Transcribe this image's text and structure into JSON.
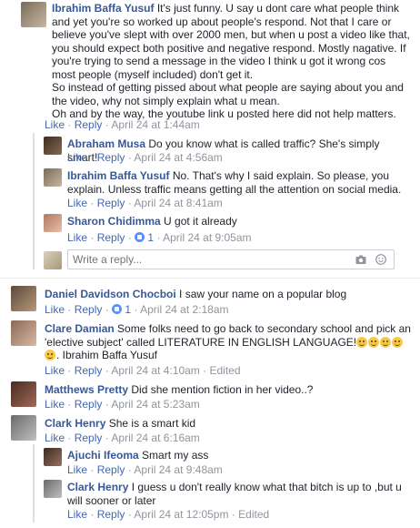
{
  "labels": {
    "like": "Like",
    "reply": "Reply",
    "dot": "·",
    "edited": "Edited"
  },
  "top_comment": {
    "author": "Ibrahim Baffa Yusuf",
    "text": "It's just funny. U say u dont care what people think and yet you're so worked up about people's respond. Not that I care or believe you've slept with over 2000 men, but when u post a video like that, you should expect both positive and negative respond. Mostly nagative. If you're trying to send a message in the video I think u got it wrong cos most people (myself included) don't get it.",
    "text2": "So instead of getting pissed about what people are saying about you and the video, why not simply explain what u mean.",
    "text3": "Oh and by the way, the youtube link u posted here did not help matters.",
    "time": "April 24 at 1:44am"
  },
  "replies": [
    {
      "author": "Abraham Musa",
      "text": "Do you know what is called traffic? She's simply smart!",
      "time": "April 24 at 4:56am"
    },
    {
      "author": "Ibrahim Baffa Yusuf",
      "text": "No. That's why I said explain. So please, you explain. Unless traffic means getting all the attention on social media.",
      "time": "April 24 at 8:41am"
    },
    {
      "author": "Sharon Chidimma",
      "text": "U got it already",
      "time": "April 24 at 9:05am",
      "likes": "1"
    }
  ],
  "reply_input": {
    "placeholder": "Write a reply..."
  },
  "comments": [
    {
      "author": "Daniel Davidson Chocboi",
      "text": "I saw your name on a popular blog",
      "time": "April 24 at 2:18am",
      "likes": "1"
    },
    {
      "author": "Clare Damian",
      "text": "Some folks need to go back to secondary school and pick an 'elective subject' called LITERATURE IN ENGLISH LANGUAGE!",
      "text_tail": ". Ibrahim Baffa Yusuf",
      "time": "April 24 at 4:10am"
    },
    {
      "author": "Matthews Pretty",
      "text": "Did she mention fiction in her video..?",
      "time": "April 24 at 5:23am"
    },
    {
      "author": "Clark Henry",
      "text": "She is a smart kid",
      "time": "April 24 at 6:16am"
    }
  ],
  "sub_replies": [
    {
      "author": "Ajuchi Ifeoma",
      "text": "Smart my ass",
      "time": "April 24 at 9:48am"
    },
    {
      "author": "Clark Henry",
      "text": "I guess u don't really know what that bitch is up to ,but u will sooner or later",
      "time": "April 24 at 12:05pm"
    }
  ],
  "colors": {
    "link": "#365899",
    "action": "#4267b2",
    "meta": "#90949c",
    "text": "#1d2129"
  }
}
